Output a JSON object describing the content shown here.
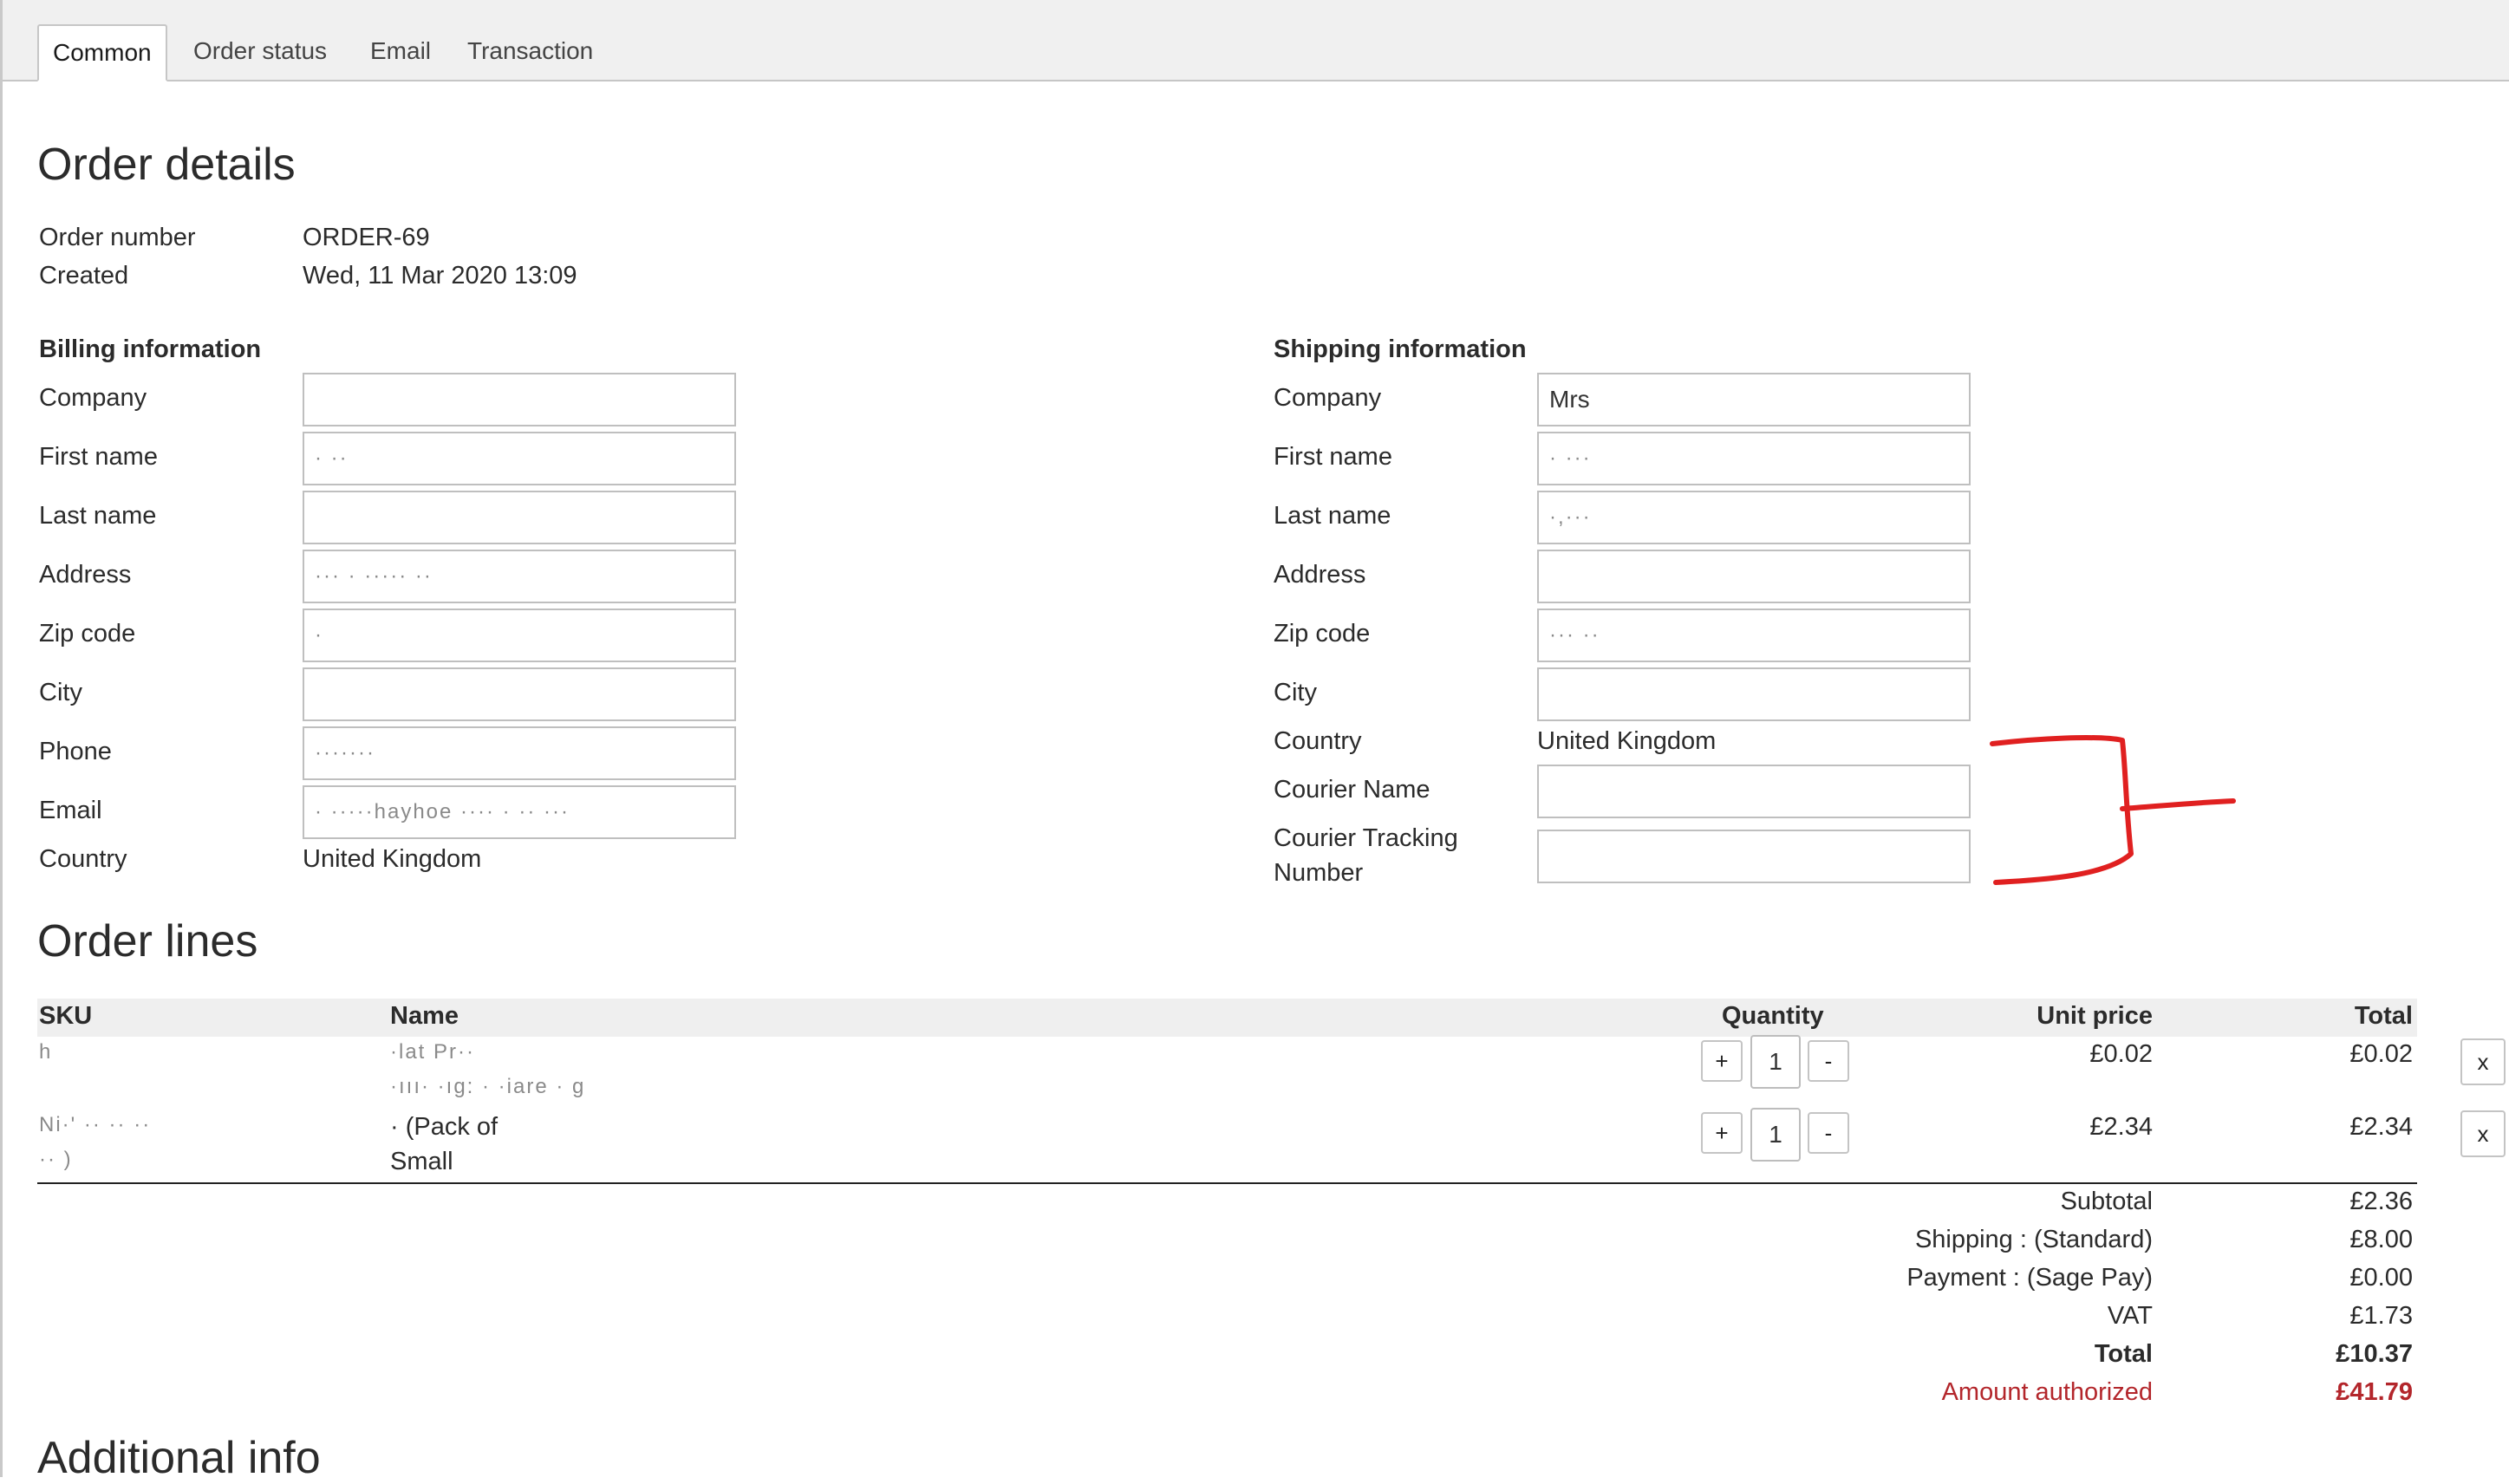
{
  "tabs": [
    "Common",
    "Order status",
    "Email",
    "Transaction"
  ],
  "order": {
    "title": "Order details",
    "number_label": "Order number",
    "number_value": "ORDER-69",
    "created_label": "Created",
    "created_value": "Wed, 11 Mar 2020 13:09"
  },
  "billing": {
    "heading": "Billing information",
    "company_label": "Company",
    "company_value": "",
    "first_label": "First name",
    "first_value": "·  ··",
    "last_label": "Last name",
    "last_value": "",
    "address_label": "Address",
    "address_value": "··· ·  ·····  ··",
    "zip_label": "Zip code",
    "zip_value": "  ·",
    "city_label": "City",
    "city_value": "",
    "phone_label": "Phone",
    "phone_value": "·······",
    "email_label": "Email",
    "email_value": "·  ·····hayhoe ···· · ·· ···",
    "country_label": "Country",
    "country_value": "United Kingdom"
  },
  "shipping": {
    "heading": "Shipping information",
    "company_label": "Company",
    "company_value": "Mrs",
    "first_label": "First name",
    "first_value": "· ···",
    "last_label": "Last name",
    "last_value": "·,···",
    "address_label": "Address",
    "address_value": "",
    "zip_label": "Zip code",
    "zip_value": "···  ··",
    "city_label": "City",
    "city_value": "",
    "country_label": "Country",
    "country_value": "United Kingdom",
    "courier_name_label": "Courier Name",
    "courier_name_value": "",
    "tracking_label_1": "Courier Tracking",
    "tracking_label_2": "Number",
    "tracking_value": ""
  },
  "lines": {
    "title": "Order lines",
    "headers": {
      "sku": "SKU",
      "name": "Name",
      "quantity": "Quantity",
      "unit_price": "Unit price",
      "total": "Total"
    },
    "rows": [
      {
        "sku": "        h",
        "name_1": "                                     ·lat Pr··",
        "name_2": "                                  ·ııı·     ·ıg:   · ·iare      ·  g",
        "qty": "1",
        "unit_price": "£0.02",
        "total": "£0.02"
      },
      {
        "sku": "Ni·'     ·· ·· ··",
        "sku_2": "·· )",
        "name_1": "                                   ·  (Pack of",
        "name_2": "Small",
        "qty": "1",
        "unit_price": "£2.34",
        "total": "£2.34"
      }
    ],
    "plus": "+",
    "minus": "-",
    "remove": "x"
  },
  "totals": {
    "subtotal_label": "Subtotal",
    "subtotal": "£2.36",
    "shipping_label": "Shipping : (Standard)",
    "shipping": "£8.00",
    "payment_label": "Payment : (Sage Pay)",
    "payment": "£0.00",
    "vat_label": "VAT",
    "vat": "£1.73",
    "total_label": "Total",
    "total": "£10.37",
    "authorized_label": "Amount authorized",
    "authorized": "£41.79"
  },
  "additional": {
    "title": "Additional info"
  },
  "colors": {
    "annotation": "#e02020",
    "authorized": "#b3262b"
  }
}
